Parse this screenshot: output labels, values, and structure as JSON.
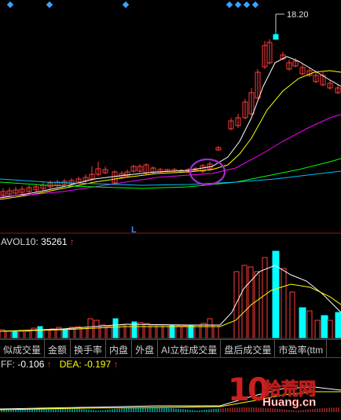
{
  "price_panel": {
    "peak_label": "18.20",
    "low_marker": "L"
  },
  "volume_panel": {
    "indicator_name": "AVOL10:",
    "indicator_value": "35261",
    "arrow": "↑"
  },
  "tabs": [
    "似成交量",
    "金额",
    "换手率",
    "内盘",
    "外盘",
    "AI立桩成交量",
    "盘后成交量",
    "市盈率(ttm"
  ],
  "macd_panel": {
    "diff_label": "FF:",
    "diff_value": "-0.106",
    "diff_arrow": "↑",
    "dea_label": "DEA:",
    "dea_value": "-0.197",
    "dea_arrow": "↑"
  },
  "watermark": {
    "number": "10",
    "chinese": "拾荒网",
    "domain": "Huang.cn"
  },
  "colors": {
    "up_candle": "#ff3b3b",
    "down_candle": "#00ffff",
    "ma_white": "#ffffff",
    "ma_yellow": "#ffff00",
    "ma_magenta": "#ff00ff",
    "ma_green": "#00ff00",
    "ma_cyan": "#00bfff",
    "highlight_circle": "#9b30c8",
    "diamond": "#3aa3ff"
  }
}
